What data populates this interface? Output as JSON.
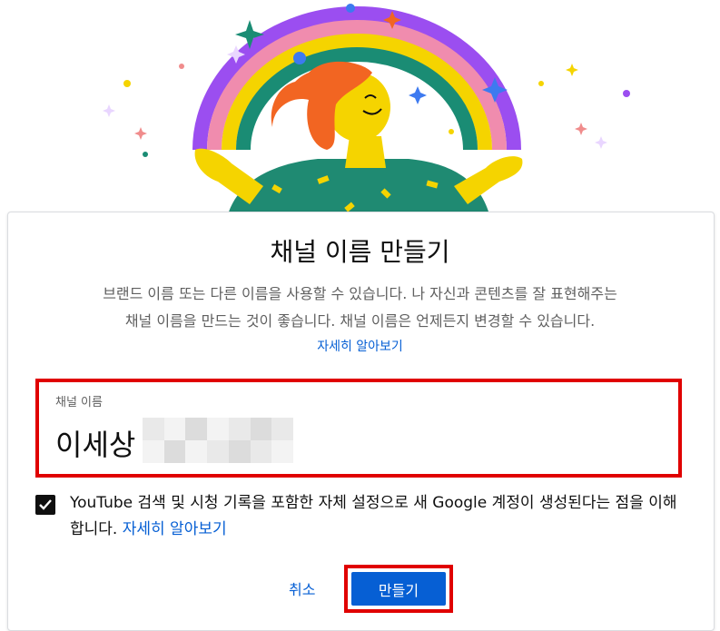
{
  "dialog": {
    "title": "채널 이름 만들기",
    "description_line1": "브랜드 이름 또는 다른 이름을 사용할 수 있습니다. 나 자신과 콘텐츠를 잘 표현해주는",
    "description_line2": "채널 이름을 만드는 것이 좋습니다. 채널 이름은 언제든지 변경할 수 있습니다.",
    "learn_more": "자세히 알아보기"
  },
  "name_field": {
    "label": "채널 이름",
    "value": "이세상"
  },
  "consent": {
    "checked": true,
    "text": "YouTube 검색 및 시청 기록을 포함한 자체 설정으로 새 Google 계정이 생성된다는 점을 이해합니다. ",
    "link": "자세히 알아보기"
  },
  "actions": {
    "cancel": "취소",
    "create": "만들기"
  },
  "colors": {
    "accent": "#065fd4",
    "highlight": "#e00000"
  }
}
